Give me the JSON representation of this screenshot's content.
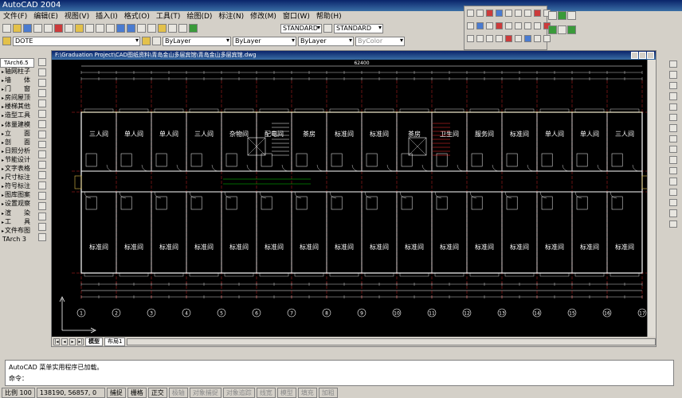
{
  "app": {
    "title": "AutoCAD 2004"
  },
  "menu": [
    "文件(F)",
    "编辑(E)",
    "视图(V)",
    "插入(I)",
    "格式(O)",
    "工具(T)",
    "绘图(D)",
    "标注(N)",
    "修改(M)",
    "窗口(W)",
    "帮助(H)"
  ],
  "toolbar": {
    "text_style": "STANDARD",
    "dim_style": "STANDARD",
    "layer": "DOTE",
    "color": "ByLayer",
    "linetype": "ByLayer",
    "lineweight": "ByLayer",
    "plotstyle": "ByColor"
  },
  "left_panel": {
    "title": "TArch6.5",
    "items": [
      "轴网柱子",
      "墙　　体",
      "门　　窗",
      "房间屋顶",
      "楼梯其他",
      "造型工具",
      "体量建模",
      "立　　面",
      "剖　　面",
      "日照分析",
      "节能设计",
      "文字表格",
      "尺寸标注",
      "符号标注",
      "图库图案",
      "设置观察",
      "渲　　染",
      "工　　具",
      "文件布图",
      "TArch 3"
    ]
  },
  "drawing": {
    "window_title": "F:\\Graduation Project\\CAD图纸资料\\青岛金山多层宾馆\\青岛金山多层宾馆.dwg",
    "tabs": [
      "模型",
      "布局1"
    ],
    "rooms_top": [
      "三人间",
      "单人间",
      "单人间",
      "三人间",
      "杂物间",
      "配电间",
      "茶房",
      "标准间",
      "标准间",
      "茶房",
      "卫生间",
      "服务间",
      "标准间",
      "单人间",
      "单人间",
      "三人间"
    ],
    "rooms_bottom": [
      "标准间",
      "标准间",
      "标准间",
      "标准间",
      "标准间",
      "标准间",
      "标准间",
      "标准间",
      "标准间",
      "标准间",
      "标准间",
      "标准间",
      "标准间",
      "标准间",
      "标准间",
      "标准间"
    ],
    "axis_numbers": [
      "1",
      "2",
      "3",
      "4",
      "5",
      "6",
      "7",
      "8",
      "9",
      "10",
      "11",
      "12",
      "13",
      "14",
      "15",
      "16",
      "17"
    ],
    "overall_dim": "62400",
    "colors": {
      "wall": "#ffffff",
      "axis": "#ff2d2d",
      "text": "#ffffff",
      "hatch": "#ff2d2d",
      "green": "#00d000",
      "yellow": "#e3c14a"
    }
  },
  "command": {
    "line1": "AutoCAD 菜单实用程序已加载。",
    "prompt": "命令："
  },
  "status": {
    "scale": "比例 100",
    "coords": "138190, 56857, 0",
    "buttons": [
      {
        "label": "捕捉",
        "on": true
      },
      {
        "label": "栅格",
        "on": true
      },
      {
        "label": "正交",
        "on": true
      },
      {
        "label": "极轴",
        "on": false
      },
      {
        "label": "对象捕捉",
        "on": false
      },
      {
        "label": "对象追踪",
        "on": false
      },
      {
        "label": "线宽",
        "on": false
      },
      {
        "label": "模型",
        "on": false
      },
      {
        "label": "填充",
        "on": false
      },
      {
        "label": "加粗",
        "on": false
      }
    ]
  }
}
